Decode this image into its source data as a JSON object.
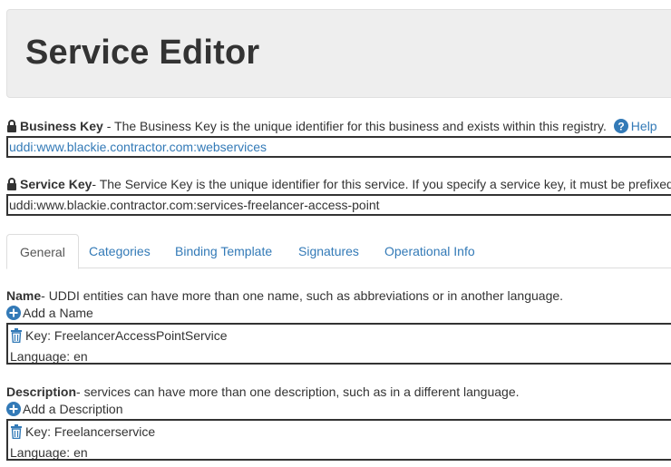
{
  "page": {
    "title": "Service Editor"
  },
  "business_key": {
    "label": "Business Key",
    "description": " - The Business Key is the unique identifier for this business and exists within this registry.",
    "help_label": "Help",
    "value": "uddi:www.blackie.contractor.com:webservices"
  },
  "service_key": {
    "label": "Service Key",
    "description": "- The Service Key is the unique identifier for this service. If you specify a service key, it must be prefixed",
    "value": "uddi:www.blackie.contractor.com:services-freelancer-access-point"
  },
  "tabs": [
    {
      "label": "General",
      "active": true
    },
    {
      "label": "Categories",
      "active": false
    },
    {
      "label": "Binding Template",
      "active": false
    },
    {
      "label": "Signatures",
      "active": false
    },
    {
      "label": "Operational Info",
      "active": false
    }
  ],
  "name_section": {
    "label": "Name",
    "description": "- UDDI entities can have more than one name, such as abbreviations or in another language.",
    "add_label": "Add a Name",
    "entry": {
      "key_text": "Key: FreelancerAccessPointService",
      "language_text": "Language: en"
    }
  },
  "description_section": {
    "label": "Description",
    "description": "- services can have more than one description, such as in a different language.",
    "add_label": "Add a Description",
    "entry": {
      "key_text": "Key: Freelancerservice",
      "language_text": "Language: en"
    }
  },
  "colors": {
    "link": "#337ab7",
    "text": "#333333",
    "jumbotron": "#eeeeee"
  },
  "icons": [
    "lock-icon",
    "help-icon",
    "plus-circle-icon",
    "trash-icon"
  ]
}
